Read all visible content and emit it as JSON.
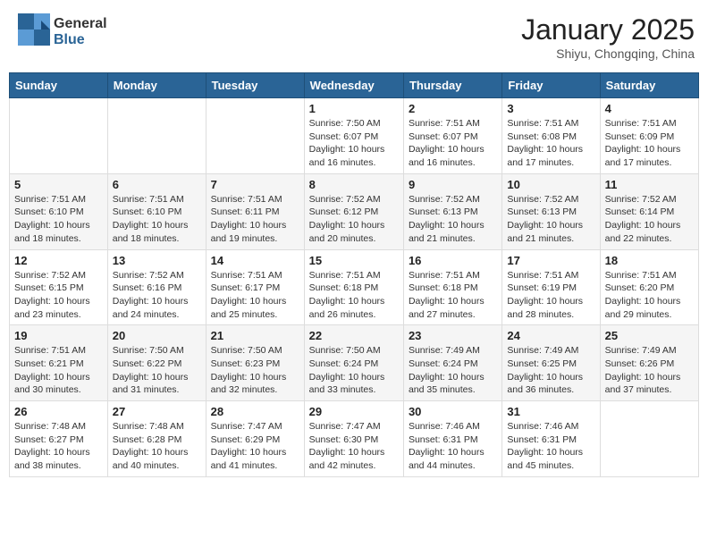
{
  "logo": {
    "general": "General",
    "blue": "Blue"
  },
  "header": {
    "month": "January 2025",
    "location": "Shiyu, Chongqing, China"
  },
  "weekdays": [
    "Sunday",
    "Monday",
    "Tuesday",
    "Wednesday",
    "Thursday",
    "Friday",
    "Saturday"
  ],
  "weeks": [
    [
      {
        "day": "",
        "info": ""
      },
      {
        "day": "",
        "info": ""
      },
      {
        "day": "",
        "info": ""
      },
      {
        "day": "1",
        "info": "Sunrise: 7:50 AM\nSunset: 6:07 PM\nDaylight: 10 hours and 16 minutes."
      },
      {
        "day": "2",
        "info": "Sunrise: 7:51 AM\nSunset: 6:07 PM\nDaylight: 10 hours and 16 minutes."
      },
      {
        "day": "3",
        "info": "Sunrise: 7:51 AM\nSunset: 6:08 PM\nDaylight: 10 hours and 17 minutes."
      },
      {
        "day": "4",
        "info": "Sunrise: 7:51 AM\nSunset: 6:09 PM\nDaylight: 10 hours and 17 minutes."
      }
    ],
    [
      {
        "day": "5",
        "info": "Sunrise: 7:51 AM\nSunset: 6:10 PM\nDaylight: 10 hours and 18 minutes."
      },
      {
        "day": "6",
        "info": "Sunrise: 7:51 AM\nSunset: 6:10 PM\nDaylight: 10 hours and 18 minutes."
      },
      {
        "day": "7",
        "info": "Sunrise: 7:51 AM\nSunset: 6:11 PM\nDaylight: 10 hours and 19 minutes."
      },
      {
        "day": "8",
        "info": "Sunrise: 7:52 AM\nSunset: 6:12 PM\nDaylight: 10 hours and 20 minutes."
      },
      {
        "day": "9",
        "info": "Sunrise: 7:52 AM\nSunset: 6:13 PM\nDaylight: 10 hours and 21 minutes."
      },
      {
        "day": "10",
        "info": "Sunrise: 7:52 AM\nSunset: 6:13 PM\nDaylight: 10 hours and 21 minutes."
      },
      {
        "day": "11",
        "info": "Sunrise: 7:52 AM\nSunset: 6:14 PM\nDaylight: 10 hours and 22 minutes."
      }
    ],
    [
      {
        "day": "12",
        "info": "Sunrise: 7:52 AM\nSunset: 6:15 PM\nDaylight: 10 hours and 23 minutes."
      },
      {
        "day": "13",
        "info": "Sunrise: 7:52 AM\nSunset: 6:16 PM\nDaylight: 10 hours and 24 minutes."
      },
      {
        "day": "14",
        "info": "Sunrise: 7:51 AM\nSunset: 6:17 PM\nDaylight: 10 hours and 25 minutes."
      },
      {
        "day": "15",
        "info": "Sunrise: 7:51 AM\nSunset: 6:18 PM\nDaylight: 10 hours and 26 minutes."
      },
      {
        "day": "16",
        "info": "Sunrise: 7:51 AM\nSunset: 6:18 PM\nDaylight: 10 hours and 27 minutes."
      },
      {
        "day": "17",
        "info": "Sunrise: 7:51 AM\nSunset: 6:19 PM\nDaylight: 10 hours and 28 minutes."
      },
      {
        "day": "18",
        "info": "Sunrise: 7:51 AM\nSunset: 6:20 PM\nDaylight: 10 hours and 29 minutes."
      }
    ],
    [
      {
        "day": "19",
        "info": "Sunrise: 7:51 AM\nSunset: 6:21 PM\nDaylight: 10 hours and 30 minutes."
      },
      {
        "day": "20",
        "info": "Sunrise: 7:50 AM\nSunset: 6:22 PM\nDaylight: 10 hours and 31 minutes."
      },
      {
        "day": "21",
        "info": "Sunrise: 7:50 AM\nSunset: 6:23 PM\nDaylight: 10 hours and 32 minutes."
      },
      {
        "day": "22",
        "info": "Sunrise: 7:50 AM\nSunset: 6:24 PM\nDaylight: 10 hours and 33 minutes."
      },
      {
        "day": "23",
        "info": "Sunrise: 7:49 AM\nSunset: 6:24 PM\nDaylight: 10 hours and 35 minutes."
      },
      {
        "day": "24",
        "info": "Sunrise: 7:49 AM\nSunset: 6:25 PM\nDaylight: 10 hours and 36 minutes."
      },
      {
        "day": "25",
        "info": "Sunrise: 7:49 AM\nSunset: 6:26 PM\nDaylight: 10 hours and 37 minutes."
      }
    ],
    [
      {
        "day": "26",
        "info": "Sunrise: 7:48 AM\nSunset: 6:27 PM\nDaylight: 10 hours and 38 minutes."
      },
      {
        "day": "27",
        "info": "Sunrise: 7:48 AM\nSunset: 6:28 PM\nDaylight: 10 hours and 40 minutes."
      },
      {
        "day": "28",
        "info": "Sunrise: 7:47 AM\nSunset: 6:29 PM\nDaylight: 10 hours and 41 minutes."
      },
      {
        "day": "29",
        "info": "Sunrise: 7:47 AM\nSunset: 6:30 PM\nDaylight: 10 hours and 42 minutes."
      },
      {
        "day": "30",
        "info": "Sunrise: 7:46 AM\nSunset: 6:31 PM\nDaylight: 10 hours and 44 minutes."
      },
      {
        "day": "31",
        "info": "Sunrise: 7:46 AM\nSunset: 6:31 PM\nDaylight: 10 hours and 45 minutes."
      },
      {
        "day": "",
        "info": ""
      }
    ]
  ]
}
